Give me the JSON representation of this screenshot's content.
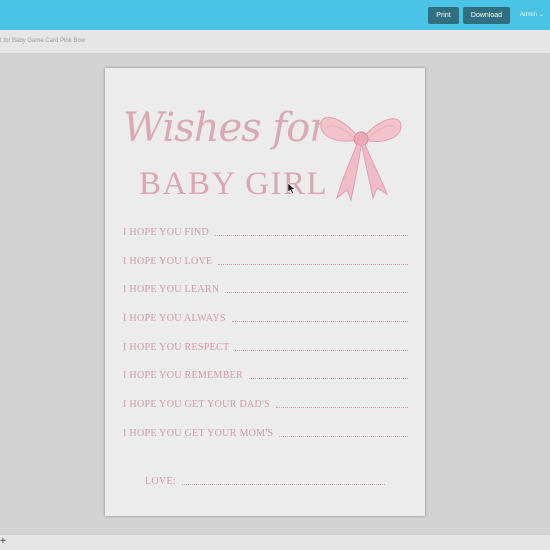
{
  "toolbar": {
    "print_label": "Print",
    "download_label": "Download",
    "admin_label": "Admin",
    "accent_color": "#4ac3e4"
  },
  "breadcrumb": {
    "text": "t for Baby Game Card Pink Bow"
  },
  "card": {
    "title_script": "Wishes for",
    "title_main": "BABY GIRL",
    "lines": [
      "I HOPE YOU FIND",
      "I HOPE YOU LOVE",
      "I HOPE YOU LEARN",
      "I HOPE YOU ALWAYS",
      "I HOPE YOU RESPECT",
      "I HOPE YOU REMEMBER",
      "I HOPE YOU GET YOUR DAD'S",
      "I HOPE YOU GET YOUR MOM'S"
    ],
    "love_label": "LOVE:",
    "text_color": "#d29aa7",
    "bow_icon": "pink-bow"
  },
  "bottom": {
    "plus_label": "+"
  }
}
